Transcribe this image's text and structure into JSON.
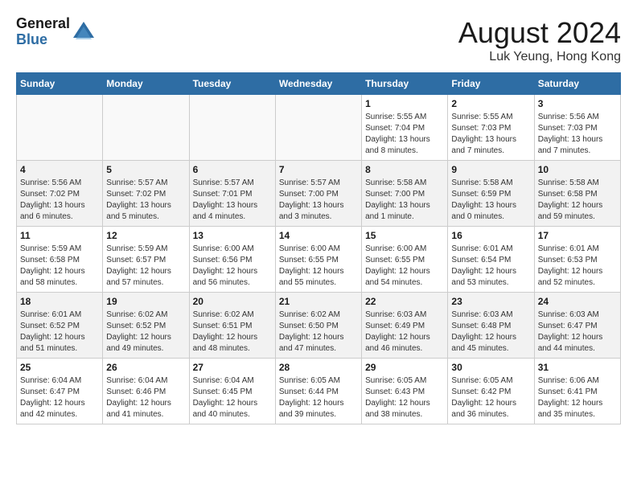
{
  "header": {
    "logo_general": "General",
    "logo_blue": "Blue",
    "month_year": "August 2024",
    "location": "Luk Yeung, Hong Kong"
  },
  "weekdays": [
    "Sunday",
    "Monday",
    "Tuesday",
    "Wednesday",
    "Thursday",
    "Friday",
    "Saturday"
  ],
  "weeks": [
    [
      {
        "day": "",
        "info": ""
      },
      {
        "day": "",
        "info": ""
      },
      {
        "day": "",
        "info": ""
      },
      {
        "day": "",
        "info": ""
      },
      {
        "day": "1",
        "info": "Sunrise: 5:55 AM\nSunset: 7:04 PM\nDaylight: 13 hours\nand 8 minutes."
      },
      {
        "day": "2",
        "info": "Sunrise: 5:55 AM\nSunset: 7:03 PM\nDaylight: 13 hours\nand 7 minutes."
      },
      {
        "day": "3",
        "info": "Sunrise: 5:56 AM\nSunset: 7:03 PM\nDaylight: 13 hours\nand 7 minutes."
      }
    ],
    [
      {
        "day": "4",
        "info": "Sunrise: 5:56 AM\nSunset: 7:02 PM\nDaylight: 13 hours\nand 6 minutes."
      },
      {
        "day": "5",
        "info": "Sunrise: 5:57 AM\nSunset: 7:02 PM\nDaylight: 13 hours\nand 5 minutes."
      },
      {
        "day": "6",
        "info": "Sunrise: 5:57 AM\nSunset: 7:01 PM\nDaylight: 13 hours\nand 4 minutes."
      },
      {
        "day": "7",
        "info": "Sunrise: 5:57 AM\nSunset: 7:00 PM\nDaylight: 13 hours\nand 3 minutes."
      },
      {
        "day": "8",
        "info": "Sunrise: 5:58 AM\nSunset: 7:00 PM\nDaylight: 13 hours\nand 1 minute."
      },
      {
        "day": "9",
        "info": "Sunrise: 5:58 AM\nSunset: 6:59 PM\nDaylight: 13 hours\nand 0 minutes."
      },
      {
        "day": "10",
        "info": "Sunrise: 5:58 AM\nSunset: 6:58 PM\nDaylight: 12 hours\nand 59 minutes."
      }
    ],
    [
      {
        "day": "11",
        "info": "Sunrise: 5:59 AM\nSunset: 6:58 PM\nDaylight: 12 hours\nand 58 minutes."
      },
      {
        "day": "12",
        "info": "Sunrise: 5:59 AM\nSunset: 6:57 PM\nDaylight: 12 hours\nand 57 minutes."
      },
      {
        "day": "13",
        "info": "Sunrise: 6:00 AM\nSunset: 6:56 PM\nDaylight: 12 hours\nand 56 minutes."
      },
      {
        "day": "14",
        "info": "Sunrise: 6:00 AM\nSunset: 6:55 PM\nDaylight: 12 hours\nand 55 minutes."
      },
      {
        "day": "15",
        "info": "Sunrise: 6:00 AM\nSunset: 6:55 PM\nDaylight: 12 hours\nand 54 minutes."
      },
      {
        "day": "16",
        "info": "Sunrise: 6:01 AM\nSunset: 6:54 PM\nDaylight: 12 hours\nand 53 minutes."
      },
      {
        "day": "17",
        "info": "Sunrise: 6:01 AM\nSunset: 6:53 PM\nDaylight: 12 hours\nand 52 minutes."
      }
    ],
    [
      {
        "day": "18",
        "info": "Sunrise: 6:01 AM\nSunset: 6:52 PM\nDaylight: 12 hours\nand 51 minutes."
      },
      {
        "day": "19",
        "info": "Sunrise: 6:02 AM\nSunset: 6:52 PM\nDaylight: 12 hours\nand 49 minutes."
      },
      {
        "day": "20",
        "info": "Sunrise: 6:02 AM\nSunset: 6:51 PM\nDaylight: 12 hours\nand 48 minutes."
      },
      {
        "day": "21",
        "info": "Sunrise: 6:02 AM\nSunset: 6:50 PM\nDaylight: 12 hours\nand 47 minutes."
      },
      {
        "day": "22",
        "info": "Sunrise: 6:03 AM\nSunset: 6:49 PM\nDaylight: 12 hours\nand 46 minutes."
      },
      {
        "day": "23",
        "info": "Sunrise: 6:03 AM\nSunset: 6:48 PM\nDaylight: 12 hours\nand 45 minutes."
      },
      {
        "day": "24",
        "info": "Sunrise: 6:03 AM\nSunset: 6:47 PM\nDaylight: 12 hours\nand 44 minutes."
      }
    ],
    [
      {
        "day": "25",
        "info": "Sunrise: 6:04 AM\nSunset: 6:47 PM\nDaylight: 12 hours\nand 42 minutes."
      },
      {
        "day": "26",
        "info": "Sunrise: 6:04 AM\nSunset: 6:46 PM\nDaylight: 12 hours\nand 41 minutes."
      },
      {
        "day": "27",
        "info": "Sunrise: 6:04 AM\nSunset: 6:45 PM\nDaylight: 12 hours\nand 40 minutes."
      },
      {
        "day": "28",
        "info": "Sunrise: 6:05 AM\nSunset: 6:44 PM\nDaylight: 12 hours\nand 39 minutes."
      },
      {
        "day": "29",
        "info": "Sunrise: 6:05 AM\nSunset: 6:43 PM\nDaylight: 12 hours\nand 38 minutes."
      },
      {
        "day": "30",
        "info": "Sunrise: 6:05 AM\nSunset: 6:42 PM\nDaylight: 12 hours\nand 36 minutes."
      },
      {
        "day": "31",
        "info": "Sunrise: 6:06 AM\nSunset: 6:41 PM\nDaylight: 12 hours\nand 35 minutes."
      }
    ]
  ]
}
